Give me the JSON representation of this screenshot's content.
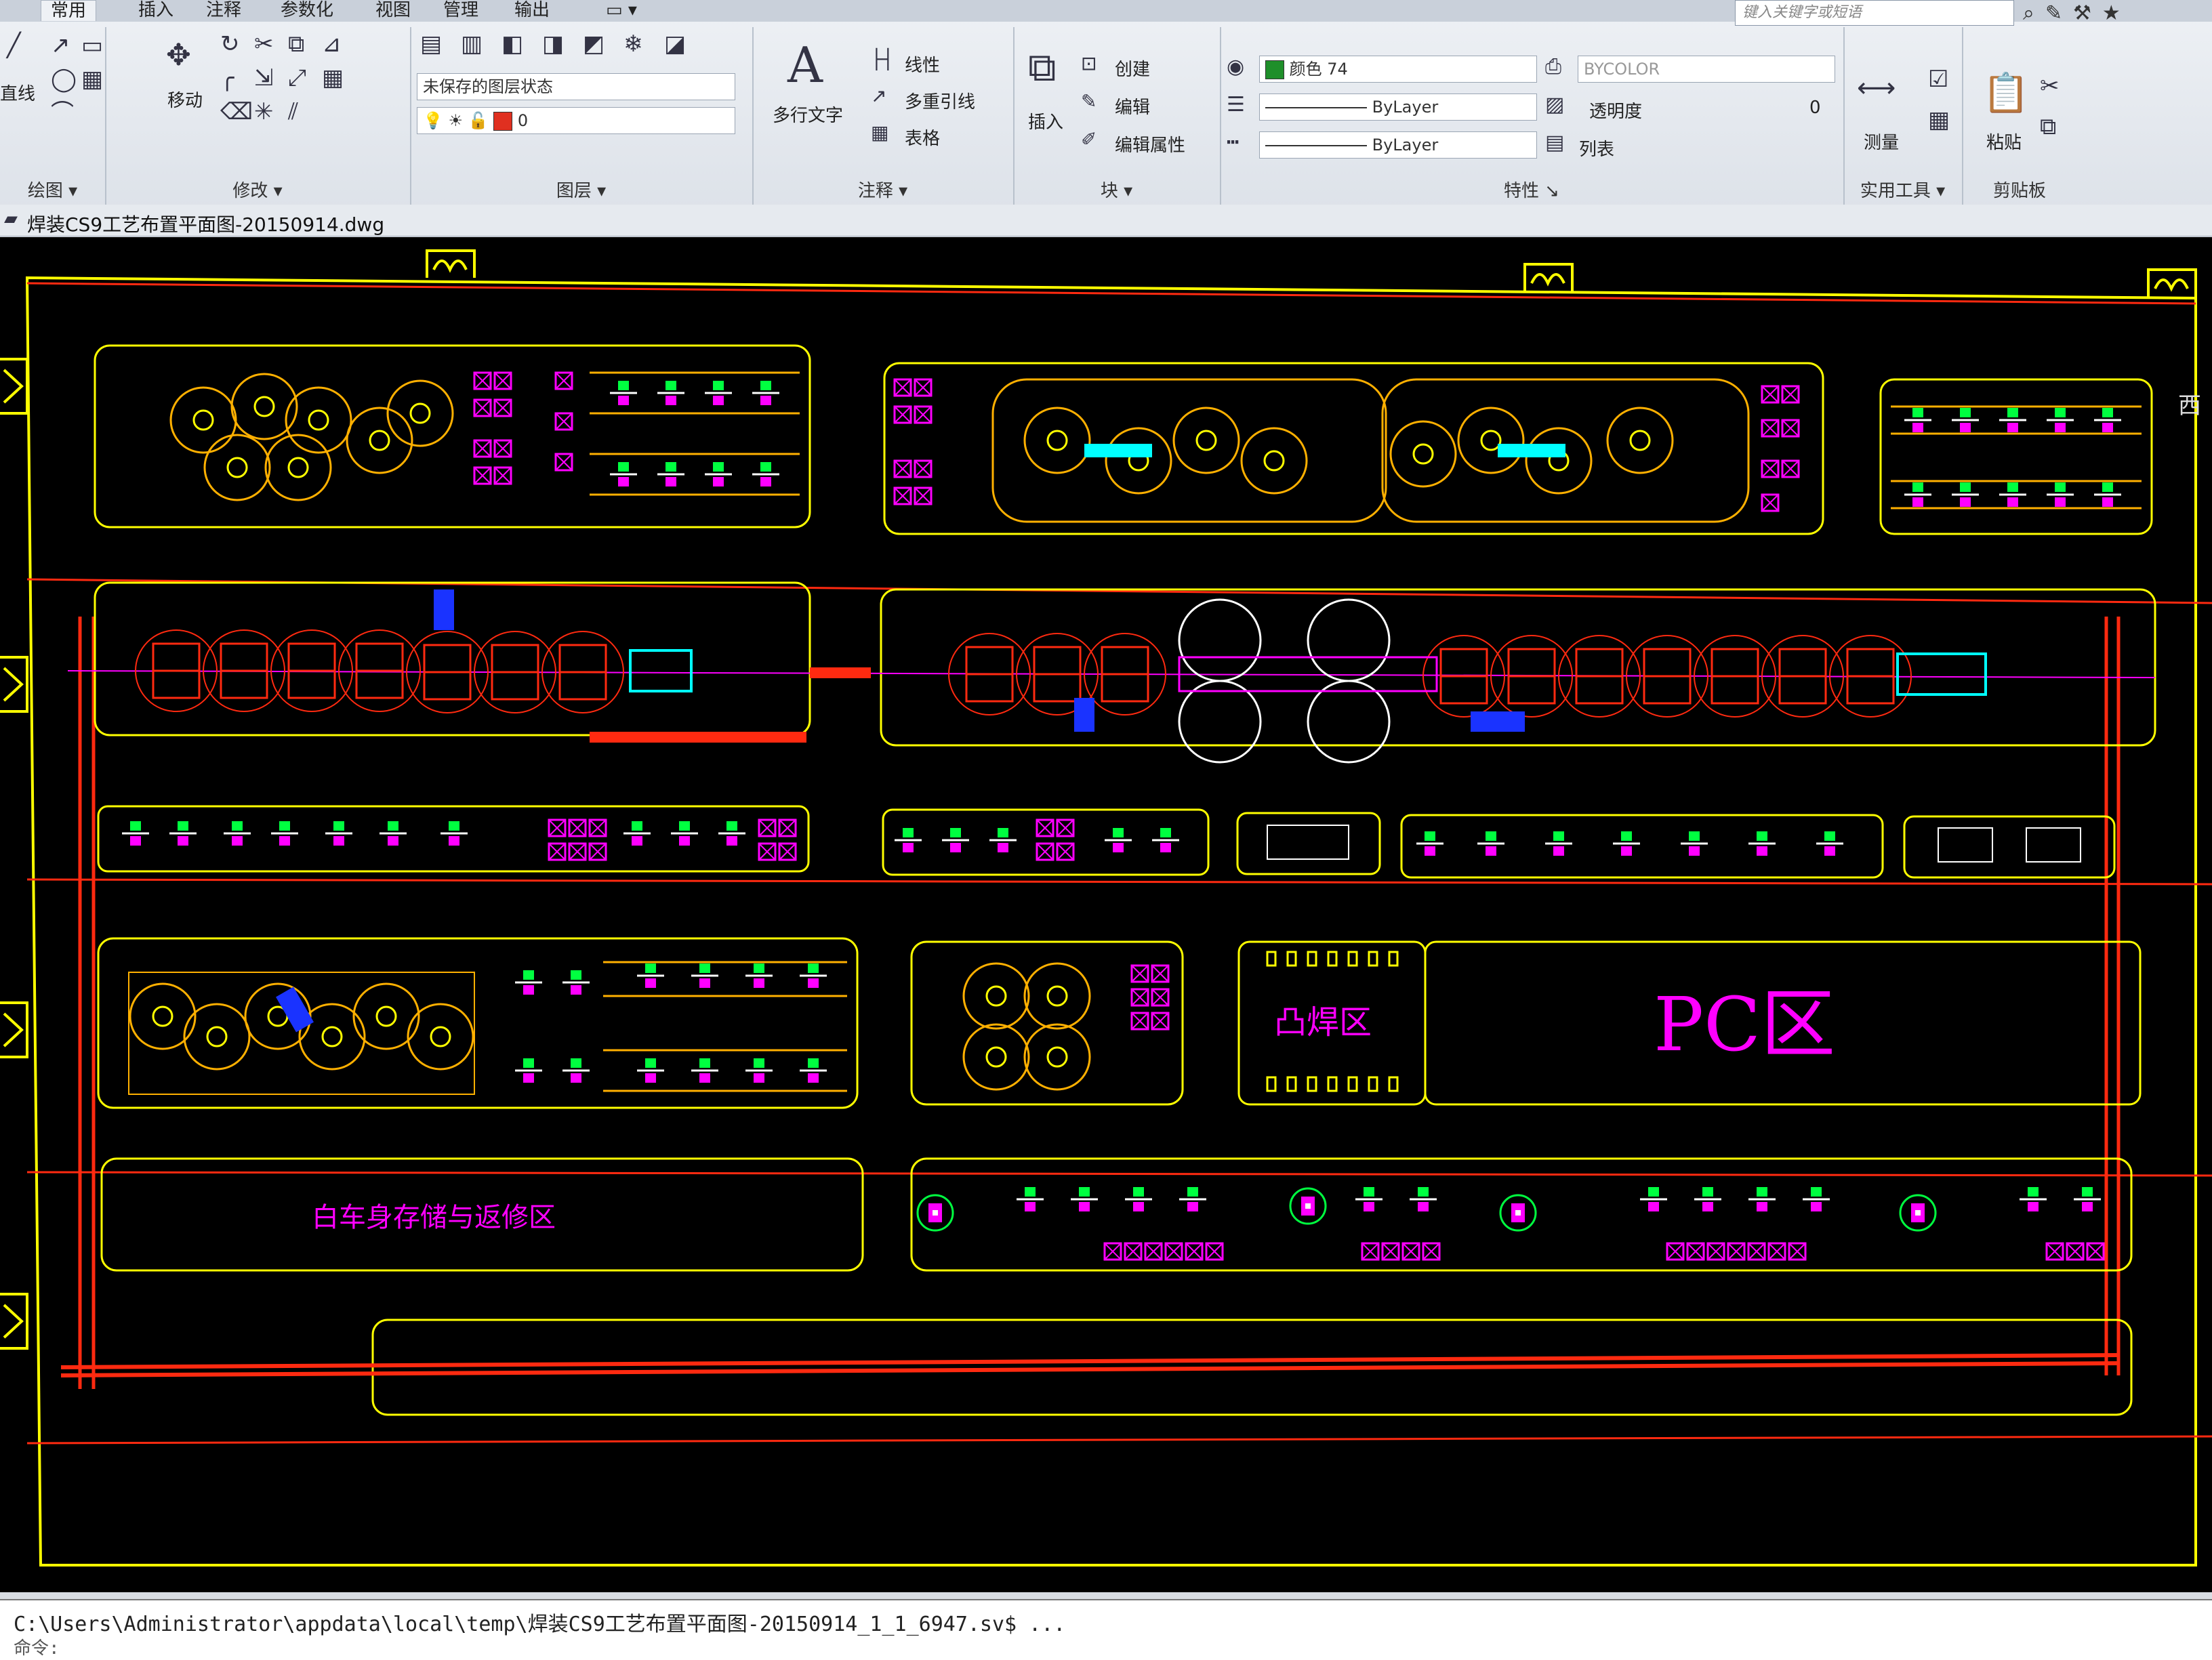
{
  "ribbon": {
    "tabs": [
      "常用",
      "插入",
      "注释",
      "参数化",
      "视图",
      "管理",
      "输出"
    ],
    "search_placeholder": "键入关键字或短语",
    "draw_panel": {
      "title": "绘图",
      "line_label": "直线"
    },
    "modify_panel": {
      "title": "修改",
      "move_label": "移动"
    },
    "layers_panel": {
      "title": "图层",
      "layer_state": "未保存的图层状态",
      "current_layer": "0"
    },
    "annotation_panel": {
      "title": "注释",
      "mtext_label": "多行文字",
      "linear_label": "线性",
      "mleader_label": "多重引线",
      "table_label": "表格"
    },
    "block_panel": {
      "title": "块",
      "insert_label": "插入",
      "create_label": "创建",
      "edit_label": "编辑",
      "edit_attr_label": "编辑属性"
    },
    "properties_panel": {
      "title": "特性",
      "color_label": "颜色 74",
      "linetype": "ByLayer",
      "lineweight": "ByLayer",
      "plot_style": "BYCOLOR",
      "transparency_label": "透明度",
      "transparency_value": "0",
      "list_label": "列表"
    },
    "utilities_panel": {
      "title": "实用工具",
      "measure_label": "测量"
    },
    "clipboard_panel": {
      "title": "剪贴板",
      "paste_label": "粘贴"
    }
  },
  "document": {
    "tab_title": "焊装CS9工艺布置平面图-20150914.dwg"
  },
  "drawing": {
    "area_labels": {
      "pc_zone": "PC区",
      "projection_weld_zone": "凸焊区",
      "body_storage_zone": "白车身存储与返修区"
    },
    "compass_label": "西",
    "colors": {
      "background": "#000000",
      "boundary": "#ffff00",
      "conveyor": "#ff2a10",
      "fixture": "#00ff40",
      "equipment": "#ff00ff",
      "robot_zone": "#ffb000",
      "cyan": "#00ffff",
      "white": "#ffffff",
      "blue": "#1a33ff"
    }
  },
  "command_line": {
    "path": "C:\\Users\\Administrator\\appdata\\local\\temp\\焊装CS9工艺布置平面图-20150914_1_1_6947.sv$ ...",
    "prompt": "命令:"
  }
}
